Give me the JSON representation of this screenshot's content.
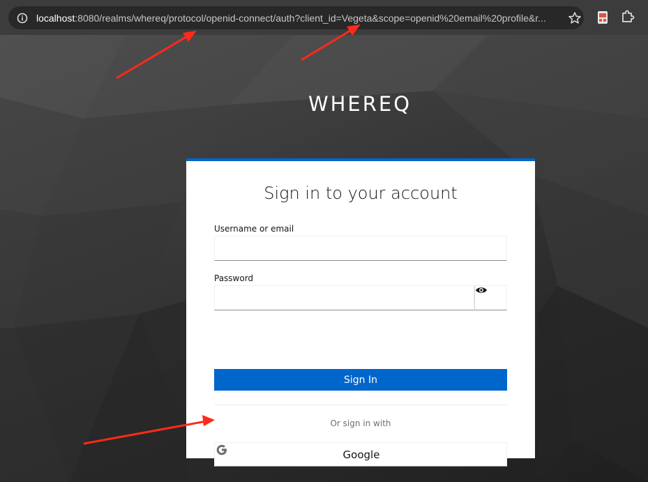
{
  "browser": {
    "url_host": "localhost",
    "url_rest": ":8080/realms/whereq/protocol/openid-connect/auth?client_id=Vegeta&scope=openid%20email%20profile&r...",
    "icons": [
      "info-icon",
      "star-icon",
      "extension-icon",
      "puzzle-icon"
    ]
  },
  "realm": {
    "title": "WHEREQ"
  },
  "login": {
    "title": "Sign in to your account",
    "username_label": "Username or email",
    "username_value": "",
    "password_label": "Password",
    "password_value": "",
    "signin_label": "Sign In",
    "or_text": "Or sign in with",
    "google_label": "Google"
  },
  "colors": {
    "accent": "#0066cc",
    "annotation_arrow": "#ff2a1a"
  }
}
